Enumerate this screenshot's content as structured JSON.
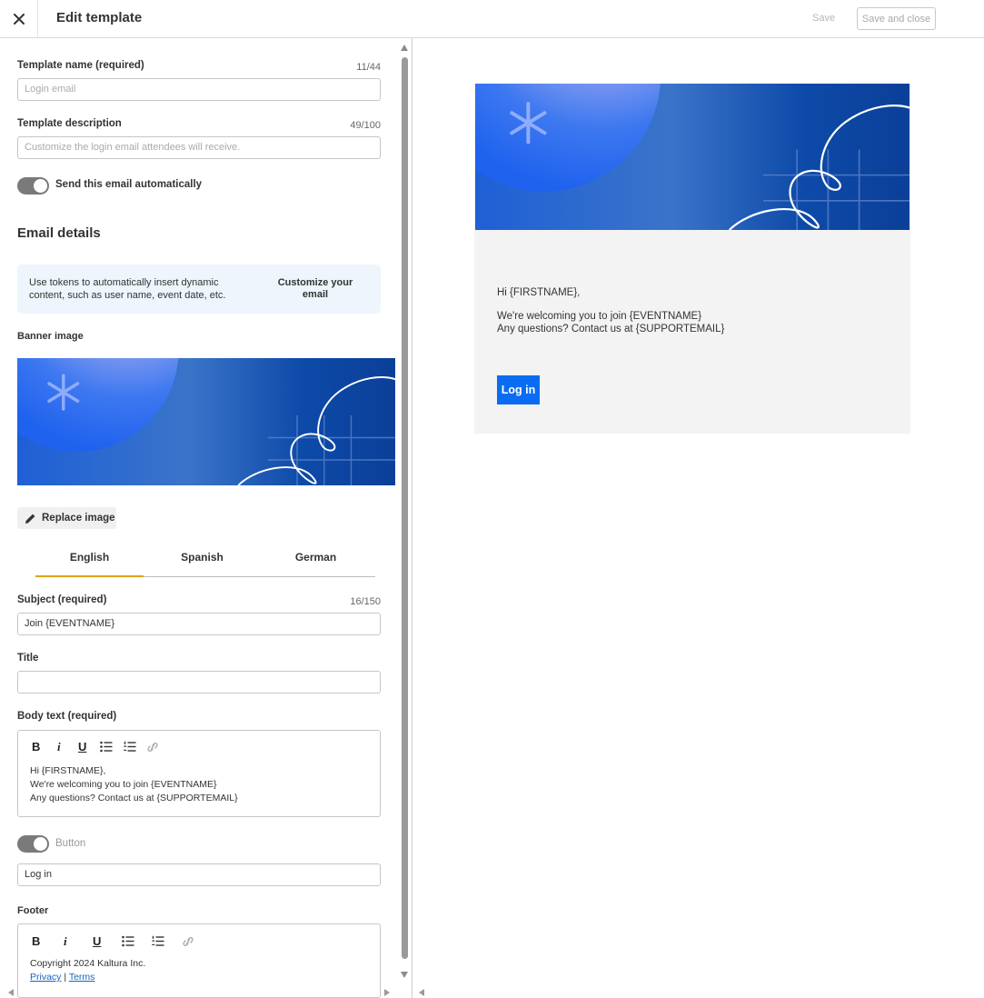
{
  "header": {
    "title": "Edit template",
    "save_label": "Save",
    "save_close_label": "Save and close"
  },
  "form": {
    "template_name": {
      "label": "Template name (required)",
      "counter": "11/44",
      "placeholder": "Login email"
    },
    "template_description": {
      "label": "Template description",
      "counter": "49/100",
      "placeholder": "Customize the login email attendees will receive."
    },
    "auto_send": {
      "label": "Send this email automatically",
      "on": true
    },
    "email_details_title": "Email details",
    "info": {
      "text": "Use tokens to automatically insert dynamic content, such as user name, event date, etc.",
      "link": "Customize your email"
    },
    "banner_label": "Banner image",
    "replace_image": "Replace image",
    "tabs": [
      "English",
      "Spanish",
      "German"
    ],
    "active_tab": "English",
    "subject": {
      "label": "Subject (required)",
      "counter": "16/150",
      "value": "Join {EVENTNAME}"
    },
    "title": {
      "label": "Title",
      "value": ""
    },
    "body": {
      "label": "Body text (required)",
      "lines": [
        "Hi {FIRSTNAME},",
        "We're welcoming you to join {EVENTNAME}",
        "Any questions? Contact us at {SUPPORTEMAIL}"
      ]
    },
    "button_toggle": {
      "label": "Button",
      "on": true
    },
    "button_text": "Log in",
    "footer": {
      "label": "Footer",
      "copyright": "Copyright 2024 Kaltura Inc.",
      "privacy": "Privacy",
      "separator": "|",
      "terms": "Terms"
    },
    "toolbar_glyphs": {
      "bold": "B",
      "italic": "i",
      "underline": "U"
    }
  },
  "preview": {
    "greeting": "Hi {FIRSTNAME},",
    "line1": "We're welcoming you to join {EVENTNAME}",
    "line2": "Any questions? Contact us at {SUPPORTEMAIL}",
    "button": "Log in"
  },
  "colors": {
    "accent_tab": "#e0a500",
    "primary_button": "#0a6cf2",
    "banner_blue": "#0b44a6"
  },
  "icons": [
    "close-icon",
    "pencil-icon",
    "bold-icon",
    "italic-icon",
    "underline-icon",
    "bullet-list-icon",
    "numbered-list-icon",
    "link-icon"
  ]
}
